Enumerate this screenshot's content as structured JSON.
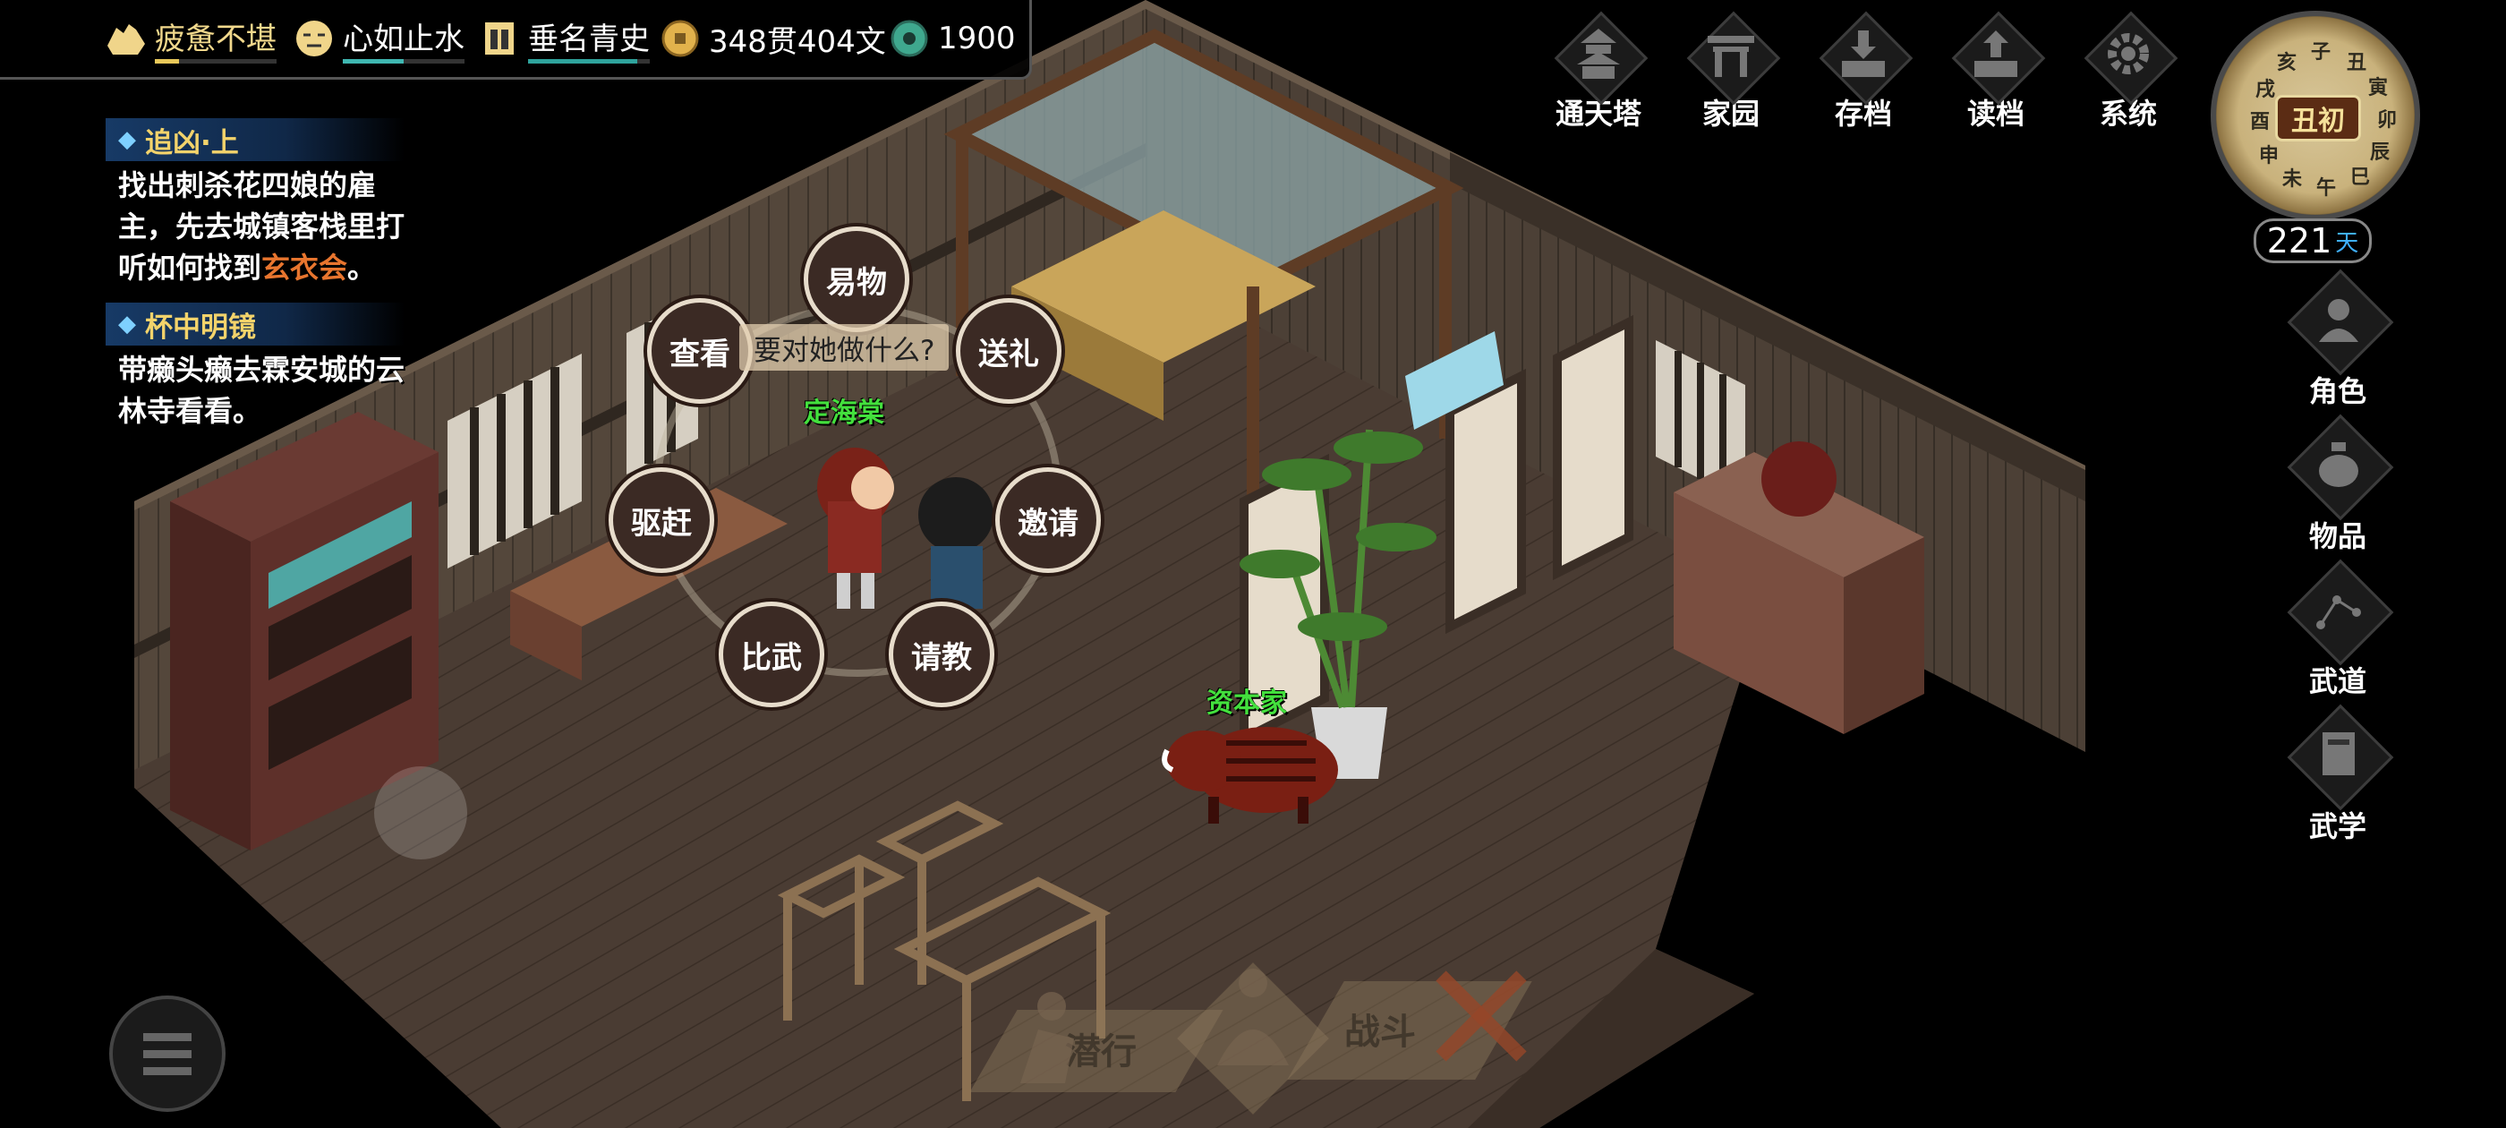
{
  "status_bar": {
    "stamina": {
      "label": "疲惫不堪",
      "level": 0.2,
      "color": "#e8c85a"
    },
    "mood": {
      "label": "心如止水",
      "level": 0.5,
      "color": "#3fb7b1"
    },
    "fame": {
      "label": "垂名青史",
      "level": 0.9,
      "color": "#2fa39c"
    },
    "money": "348贯404文",
    "jade": "1900"
  },
  "quests": [
    {
      "title": "追凶·上",
      "desc_parts": [
        "找出刺杀花四娘的雇",
        "主，先去城镇客栈里打",
        "听如何找到"
      ],
      "highlight": "玄衣会",
      "end": "。"
    },
    {
      "title": "杯中明镜",
      "desc_lines": [
        "带癞头癞去霖安城的云",
        "林寺看看。"
      ]
    }
  ],
  "top_menu": [
    "通天塔",
    "家园",
    "存档",
    "读档",
    "系统"
  ],
  "side_menu": [
    "角色",
    "物品",
    "武道",
    "武学"
  ],
  "clock": {
    "time": "丑初",
    "branches": [
      "子",
      "丑",
      "寅",
      "卯",
      "辰",
      "巳",
      "午",
      "未",
      "申",
      "酉",
      "戌",
      "亥"
    ]
  },
  "days": {
    "value": "221",
    "unit": "天"
  },
  "interaction": {
    "prompt": "要对她做什么?",
    "options": [
      "易物",
      "送礼",
      "邀请",
      "请教",
      "比武",
      "驱赶",
      "查看"
    ]
  },
  "npcs": [
    "定海棠",
    "资本家"
  ],
  "actions": {
    "sneak": "潜行",
    "fight": "战斗"
  },
  "colors": {
    "npc_name": "#43e03d",
    "highlight": "#e8752e",
    "quest_title": "#f3d36b",
    "quest_bar": "#173a66"
  }
}
